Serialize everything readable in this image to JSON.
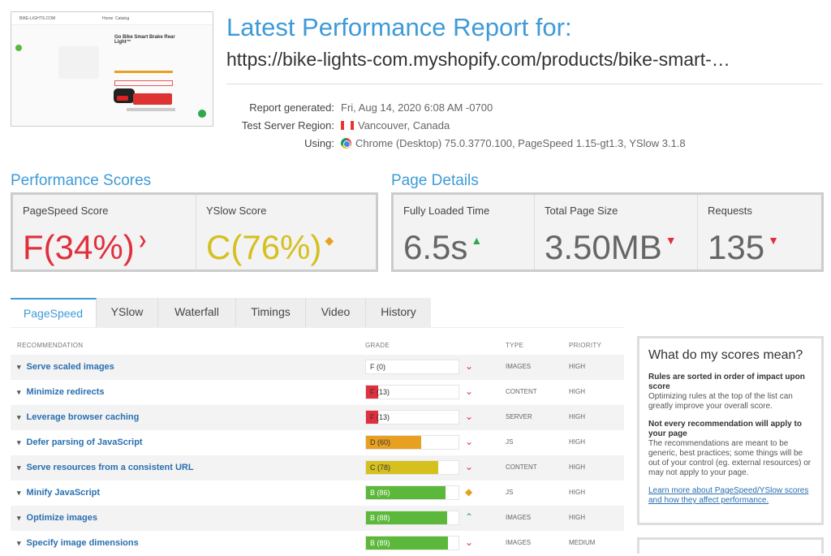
{
  "thumbnail": {
    "site": "BIKE-LIGHTS.COM",
    "nav1": "Home",
    "nav2": "Catalog",
    "product": "Go Bike Smart Brake Rear Light™"
  },
  "report": {
    "title": "Latest Performance Report for:",
    "url": "https://bike-lights-com.myshopify.com/products/bike-smart-…"
  },
  "meta": [
    {
      "label": "Report generated:",
      "value": "Fri, Aug 14, 2020 6:08 AM -0700",
      "icon": ""
    },
    {
      "label": "Test Server Region:",
      "value": "Vancouver, Canada",
      "icon": "canada-flag-icon"
    },
    {
      "label": "Using:",
      "value": "Chrome (Desktop) 75.0.3770.100, PageSpeed 1.15-gt1.3, YSlow 3.1.8",
      "icon": "chrome-icon"
    }
  ],
  "performance": {
    "heading": "Performance Scores",
    "pagespeed": {
      "label": "PageSpeed Score",
      "grade": "F",
      "pct": "(34%)"
    },
    "yslow": {
      "label": "YSlow Score",
      "grade": "C",
      "pct": "(76%)"
    }
  },
  "details": {
    "heading": "Page Details",
    "loaded": {
      "label": "Fully Loaded Time",
      "value": "6.5s"
    },
    "size": {
      "label": "Total Page Size",
      "value": "3.50MB"
    },
    "requests": {
      "label": "Requests",
      "value": "135"
    }
  },
  "tabs": [
    "PageSpeed",
    "YSlow",
    "Waterfall",
    "Timings",
    "Video",
    "History"
  ],
  "table": {
    "headers": {
      "rec": "RECOMMENDATION",
      "grade": "GRADE",
      "type": "TYPE",
      "priority": "PRIORITY"
    },
    "rows": [
      {
        "name": "Serve scaled images",
        "grade": "F (0)",
        "score": 0,
        "cls": "f",
        "trend": "down",
        "type": "IMAGES",
        "priority": "HIGH"
      },
      {
        "name": "Minimize redirects",
        "grade": "F (13)",
        "score": 13,
        "cls": "f",
        "trend": "down",
        "type": "CONTENT",
        "priority": "HIGH"
      },
      {
        "name": "Leverage browser caching",
        "grade": "F (13)",
        "score": 13,
        "cls": "f",
        "trend": "down",
        "type": "SERVER",
        "priority": "HIGH"
      },
      {
        "name": "Defer parsing of JavaScript",
        "grade": "D (60)",
        "score": 60,
        "cls": "d",
        "trend": "down",
        "type": "JS",
        "priority": "HIGH"
      },
      {
        "name": "Serve resources from a consistent URL",
        "grade": "C (78)",
        "score": 78,
        "cls": "c",
        "trend": "down",
        "type": "CONTENT",
        "priority": "HIGH"
      },
      {
        "name": "Minify JavaScript",
        "grade": "B (86)",
        "score": 86,
        "cls": "b",
        "trend": "same",
        "type": "JS",
        "priority": "HIGH"
      },
      {
        "name": "Optimize images",
        "grade": "B (88)",
        "score": 88,
        "cls": "b",
        "trend": "up",
        "type": "IMAGES",
        "priority": "HIGH"
      },
      {
        "name": "Specify image dimensions",
        "grade": "B (89)",
        "score": 89,
        "cls": "b",
        "trend": "down",
        "type": "IMAGES",
        "priority": "MEDIUM"
      }
    ]
  },
  "sidebar": {
    "title": "What do my scores mean?",
    "b1": "Rules are sorted in order of impact upon score",
    "p1": "Optimizing rules at the top of the list can greatly improve your overall score.",
    "b2": "Not every recommendation will apply to your page",
    "p2": "The recommendations are meant to be generic, best practices; some things will be out of your control (eg. external resources) or may not apply to your page.",
    "link": "Learn more about PageSpeed/YSlow scores and how they affect performance."
  }
}
